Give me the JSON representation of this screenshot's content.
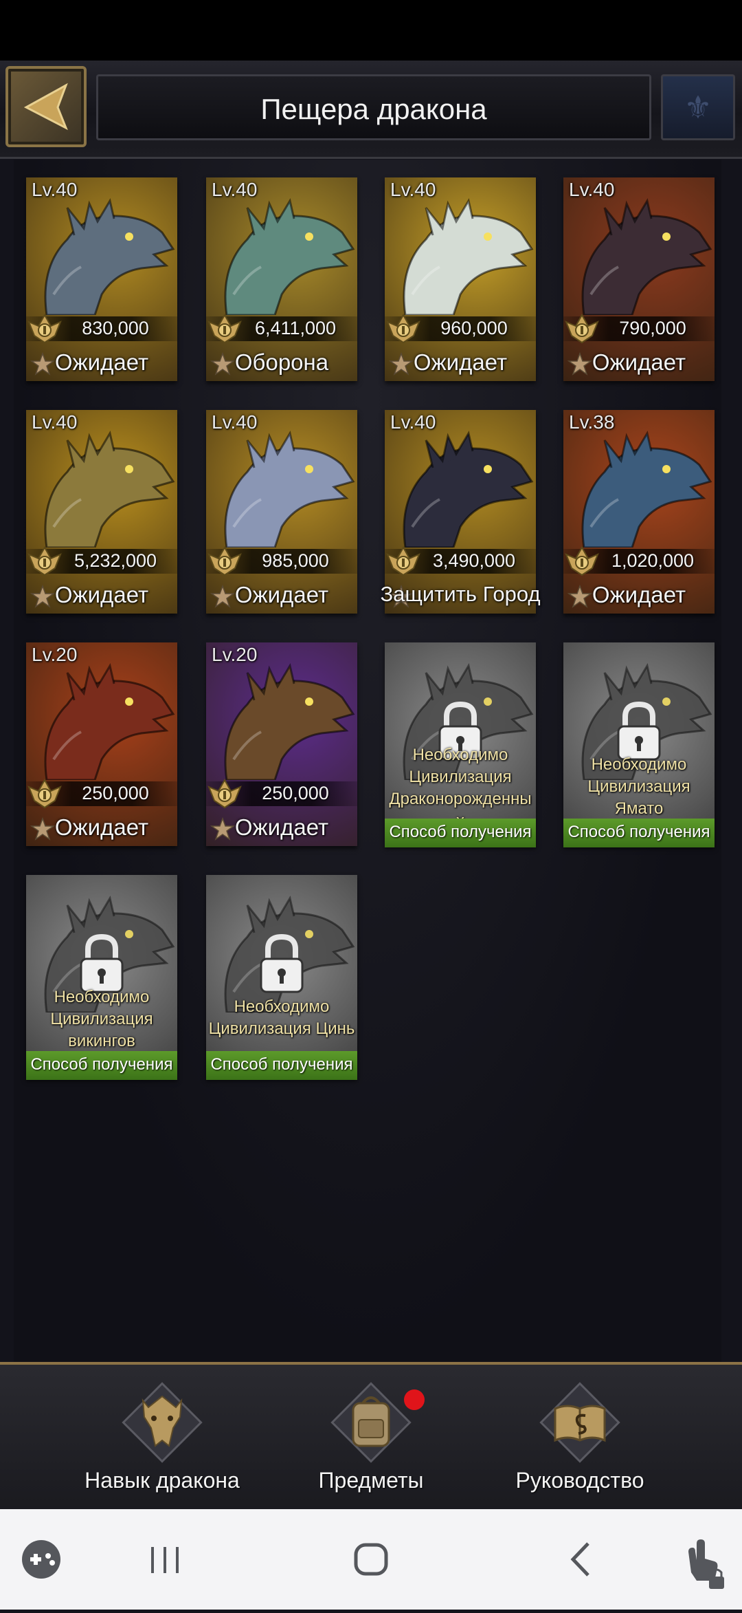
{
  "header": {
    "title": "Пещера дракона"
  },
  "dragons": [
    {
      "level": "Lv.40",
      "power": "830,000",
      "status": "Ожидает",
      "bg": "#b08a22",
      "art": "#5e6e7e"
    },
    {
      "level": "Lv.40",
      "power": "6,411,000",
      "status": "Оборона",
      "bg": "#a88a2a",
      "art": "#5f8a7e"
    },
    {
      "level": "Lv.40",
      "power": "960,000",
      "status": "Ожидает",
      "bg": "#c49e28",
      "art": "#d4dcd4"
    },
    {
      "level": "Lv.40",
      "power": "790,000",
      "status": "Ожидает",
      "bg": "#8c3a1e",
      "art": "#3c2c34"
    },
    {
      "level": "Lv.40",
      "power": "5,232,000",
      "status": "Ожидает",
      "bg": "#b88e1e",
      "art": "#8c7a3c"
    },
    {
      "level": "Lv.40",
      "power": "985,000",
      "status": "Ожидает",
      "bg": "#b48c24",
      "art": "#8a96b4"
    },
    {
      "level": "Lv.40",
      "power": "3,490,000",
      "status": "Защитить Город",
      "bg": "#b08a22",
      "art": "#2c2c3c"
    },
    {
      "level": "Lv.38",
      "power": "1,020,000",
      "status": "Ожидает",
      "bg": "#a8441c",
      "art": "#3c5c7c"
    },
    {
      "level": "Lv.20",
      "power": "250,000",
      "status": "Ожидает",
      "bg": "#a8401a",
      "art": "#7a2c1c"
    },
    {
      "level": "Lv.20",
      "power": "250,000",
      "status": "Ожидает",
      "bg": "#5c2c8c",
      "art": "#6a4a2a"
    }
  ],
  "locked": [
    {
      "lines": [
        "Необходимо",
        "Цивилизация",
        "Драконорожденны",
        "х"
      ],
      "button": "Способ получения"
    },
    {
      "lines": [
        "Необходимо",
        "Цивилизация",
        "Ямато"
      ],
      "button": "Способ получения"
    },
    {
      "lines": [
        "Необходимо",
        "Цивилизация",
        "викингов"
      ],
      "button": "Способ получения"
    },
    {
      "lines": [
        "Необходимо",
        "Цивилизация Цинь"
      ],
      "button": "Способ получения"
    }
  ],
  "bottom_nav": [
    {
      "label": "Навык дракона",
      "icon": "dragon-skill-icon"
    },
    {
      "label": "Предметы",
      "icon": "backpack-icon",
      "has_notification": true
    },
    {
      "label": "Руководство",
      "icon": "guide-book-icon"
    }
  ],
  "system_nav": [
    "game-launcher-icon",
    "recent-apps-icon",
    "home-icon",
    "back-icon",
    "touch-lock-icon"
  ],
  "colors": {
    "gold": "#c9a45a",
    "header_border": "#8c7346",
    "obtain_green": "#4f8a22",
    "notification": "#e0141a"
  }
}
